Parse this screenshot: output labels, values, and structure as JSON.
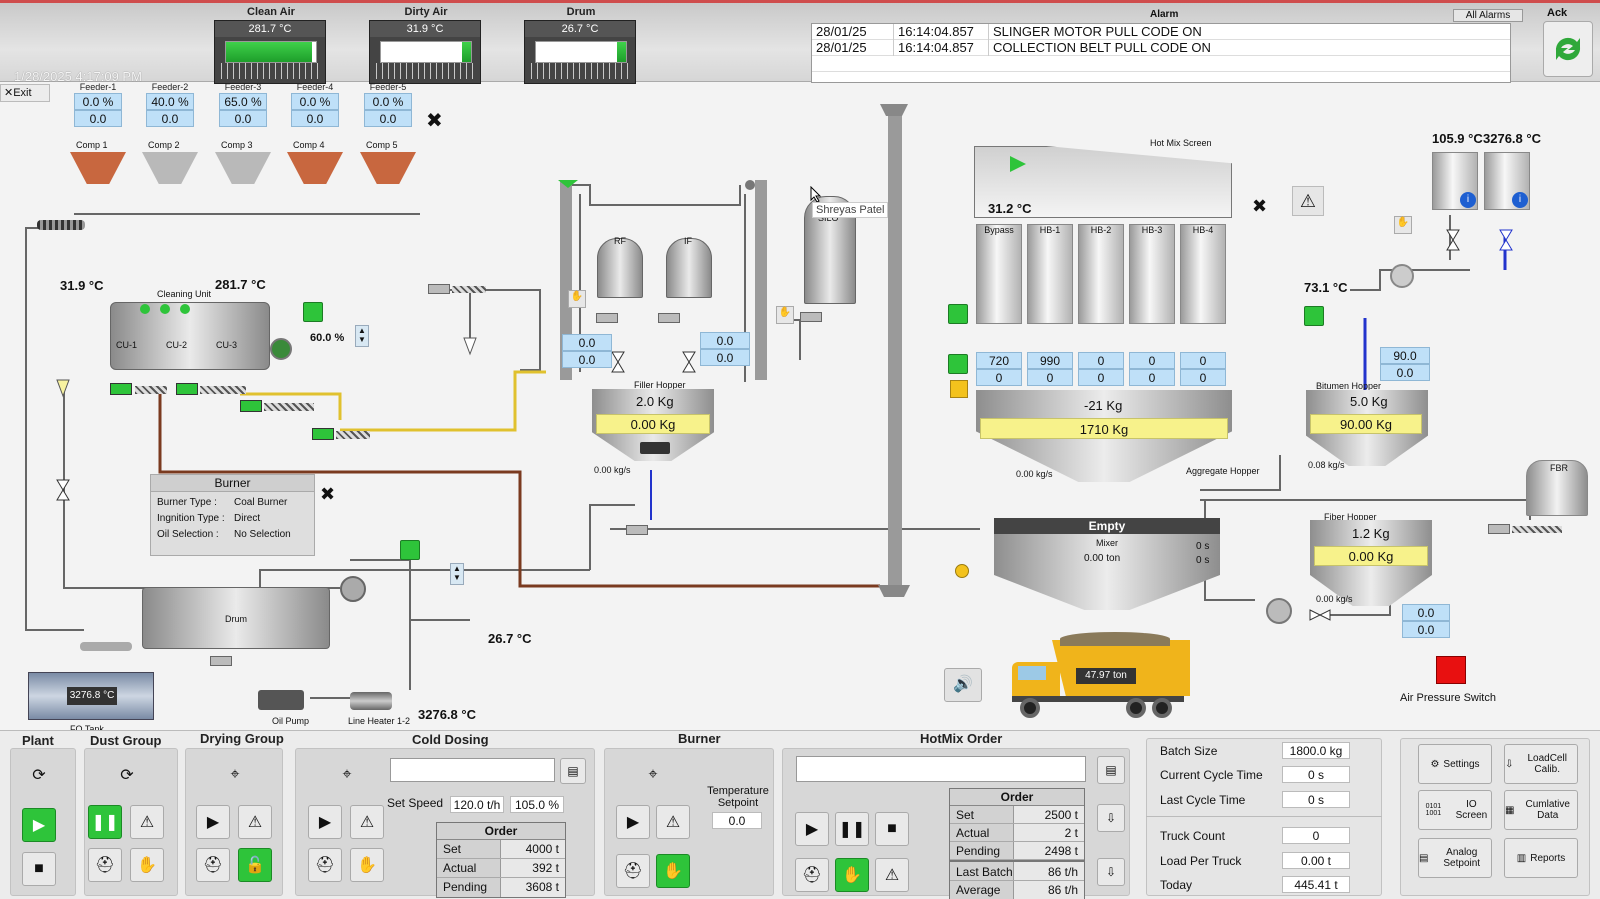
{
  "header": {
    "datetime": "1/28/2025 4:17:09 PM",
    "exit_label": "Exit",
    "gauges": [
      {
        "title": "Clean Air",
        "value": "281.7 °C",
        "fill": 0.95
      },
      {
        "title": "Dirty Air",
        "value": "31.9 °C",
        "fill": 0.9
      },
      {
        "title": "Drum",
        "value": "26.7 °C",
        "fill": 0.9
      }
    ],
    "alarm_title": "Alarm",
    "all_alarms": "All Alarms",
    "ack": "Ack",
    "alarms": [
      {
        "date": "28/01/25",
        "time": "16:14:04.857",
        "message": "SLINGER MOTOR PULL CODE ON"
      },
      {
        "date": "28/01/25",
        "time": "16:14:04.857",
        "message": "COLLECTION BELT PULL CODE ON"
      }
    ]
  },
  "feeders": [
    {
      "name": "Feeder-1",
      "pct": "0.0 %",
      "val": "0.0",
      "comp": "Comp 1",
      "color": "#c8673f"
    },
    {
      "name": "Feeder-2",
      "pct": "40.0 %",
      "val": "0.0",
      "comp": "Comp 2",
      "color": "#b9b9b9"
    },
    {
      "name": "Feeder-3",
      "pct": "65.0 %",
      "val": "0.0",
      "comp": "Comp 3",
      "color": "#b9b9b9"
    },
    {
      "name": "Feeder-4",
      "pct": "0.0 %",
      "val": "0.0",
      "comp": "Comp 4",
      "color": "#c8673f"
    },
    {
      "name": "Feeder-5",
      "pct": "0.0 %",
      "val": "0.0",
      "comp": "Comp 5",
      "color": "#c8673f"
    }
  ],
  "process": {
    "dirty_temp": "31.9 °C",
    "clean_temp": "281.7 °C",
    "cleaning_unit": "Cleaning Unit",
    "cu": [
      "CU-1",
      "CU-2",
      "CU-3"
    ],
    "damper_pct": "60.0 %",
    "burner": {
      "title": "Burner",
      "type_label": "Burner Type :",
      "type": "Coal Burner",
      "ign_label": "Ingnition Type :",
      "ign": "Direct",
      "oil_label": "Oil Selection :",
      "oil": "No Selection"
    },
    "drum_label": "Drum",
    "drum_temp": "26.7 °C",
    "fo_tank_label": "FO Tank",
    "fo_tank_temp": "3276.8 °C",
    "oil_pump": "Oil Pump",
    "line_heater": "Line Heater 1-2",
    "line_temp": "3276.8 °C",
    "rf": "RF",
    "if": "IF",
    "silo": "SILO",
    "filler_left": [
      "0.0",
      "0.0"
    ],
    "filler_right": [
      "0.0",
      "0.0"
    ],
    "filler_hopper": "Filler Hopper",
    "filler_kg": "2.0 Kg",
    "filler_set": "0.00 Kg",
    "filler_rate": "0.00 kg/s",
    "user_tooltip": "Shreyas Patel",
    "hot_mix_screen": "Hot Mix Screen",
    "screen_temp": "31.2 °C",
    "hot_bins": [
      "Bypass",
      "HB-1",
      "HB-2",
      "HB-3",
      "HB-4"
    ],
    "hot_bin_set": [
      "720",
      "990",
      "0",
      "0",
      "0"
    ],
    "hot_bin_act": [
      "0",
      "0",
      "0",
      "0",
      "0"
    ],
    "agg_kg": "-21 Kg",
    "agg_set": "1710 Kg",
    "agg_rate": "0.00 kg/s",
    "agg_hopper": "Aggregate Hopper",
    "bit_temps": "105.9 °C",
    "bit_temps2": "3276.8 °C",
    "bit_line_temp": "73.1 °C",
    "bit_box": [
      "90.0",
      "0.0"
    ],
    "bit_hopper": "Bitumen Hopper",
    "bit_kg": "5.0 Kg",
    "bit_set": "90.00 Kg",
    "bit_rate": "0.08 kg/s",
    "mixer_status": "Empty",
    "mixer_label": "Mixer",
    "mixer_ton": "0.00 ton",
    "mixer_t1": "0 s",
    "mixer_t2": "0 s",
    "fiber_hopper": "Fiber Hopper",
    "fiber_kg": "1.2 Kg",
    "fiber_set": "0.00 Kg",
    "fiber_rate": "0.00 kg/s",
    "fiber_box": [
      "0.0",
      "0.0"
    ],
    "fbr": "FBR",
    "truck_ton": "47.97 ton",
    "air_pressure": "Air Pressure Switch"
  },
  "groups": {
    "plant": "Plant",
    "dust": "Dust Group",
    "drying": "Drying Group",
    "cold": "Cold Dosing",
    "burner": "Burner",
    "hotmix": "HotMix Order"
  },
  "cold": {
    "set_speed_label": "Set Speed",
    "set_speed": "120.0 t/h",
    "pct": "105.0 %",
    "order_title": "Order",
    "rows": [
      {
        "k": "Set",
        "v": "4000 t"
      },
      {
        "k": "Actual",
        "v": "392 t"
      },
      {
        "k": "Pending",
        "v": "3608 t"
      }
    ]
  },
  "burner_ctrl": {
    "sp_label": "Temperature Setpoint",
    "sp": "0.0"
  },
  "hotmix": {
    "order_title": "Order",
    "rows": [
      {
        "k": "Set",
        "v": "2500 t"
      },
      {
        "k": "Actual",
        "v": "2 t"
      },
      {
        "k": "Pending",
        "v": "2498 t"
      },
      {
        "k": "Last Batch",
        "v": "86 t/h"
      },
      {
        "k": "Average",
        "v": "86 t/h"
      }
    ]
  },
  "stats": [
    {
      "k": "Batch Size",
      "v": "1800.0 kg"
    },
    {
      "k": "Current Cycle Time",
      "v": "0 s"
    },
    {
      "k": "Last Cycle Time",
      "v": "0 s"
    },
    {
      "k": "Truck Count",
      "v": "0"
    },
    {
      "k": "Load Per Truck",
      "v": "0.00 t"
    },
    {
      "k": "Today",
      "v": "445.41 t"
    }
  ],
  "nav": {
    "settings": "Settings",
    "loadcell": "LoadCell Calib.",
    "io": "IO Screen",
    "cumulative": "Cumlative Data",
    "analog": "Analog Setpoint",
    "reports": "Reports",
    "io_icon": "0101 1001"
  }
}
